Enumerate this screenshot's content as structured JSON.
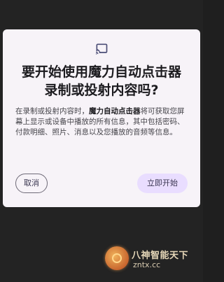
{
  "dialog": {
    "icon": "cast-icon",
    "title": "要开始使用魔力自动点击器录制或投射内容吗?",
    "body_prefix": "在录制或投射内容时，",
    "app_name": "魔力自动点击器",
    "body_suffix": "将可获取您屏幕上显示或设备中播放的所有信息，其中包括密码、付款明细、照片、消息以及您播放的音频等信息。",
    "cancel_label": "取消",
    "start_label": "立即开始"
  },
  "watermark": {
    "text": "八神智能天下",
    "site": "zntx.cc"
  }
}
